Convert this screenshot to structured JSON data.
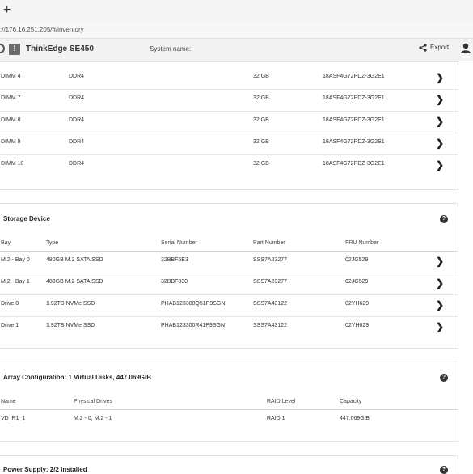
{
  "browser": {
    "new_tab": "+",
    "url": "://176.16.251.205/#/inventory"
  },
  "header": {
    "product_name": "ThinkEdge SE450",
    "system_name_label": "System name:",
    "export_label": "Export",
    "warn_glyph": "!"
  },
  "memory": {
    "rows": [
      {
        "name": "DIMM 4",
        "type": "DDR4",
        "size": "32 GB",
        "part": "18ASF4G72PDZ-3G2E1"
      },
      {
        "name": "DIMM 7",
        "type": "DDR4",
        "size": "32 GB",
        "part": "18ASF4G72PDZ-3G2E1"
      },
      {
        "name": "DIMM 8",
        "type": "DDR4",
        "size": "32 GB",
        "part": "18ASF4G72PDZ-3G2E1"
      },
      {
        "name": "DIMM 9",
        "type": "DDR4",
        "size": "32 GB",
        "part": "18ASF4G72PDZ-3G2E1"
      },
      {
        "name": "DIMM 10",
        "type": "DDR4",
        "size": "32 GB",
        "part": "18ASF4G72PDZ-3G2E1"
      }
    ]
  },
  "storage": {
    "title": "Storage Device",
    "columns": [
      "Bay",
      "Type",
      "Serial Number",
      "Part Number",
      "FRU Number"
    ],
    "rows": [
      {
        "bay": "M.2 - Bay 0",
        "type": "480GB M.2 SATA SSD",
        "serial": "32BBF5E3",
        "part": "SSS7A23277",
        "fru": "02JG529"
      },
      {
        "bay": "M.2 - Bay 1",
        "type": "480GB M.2 SATA SSD",
        "serial": "32BBF830",
        "part": "SSS7A23277",
        "fru": "02JG529"
      },
      {
        "bay": "Drive 0",
        "type": "1.92TB NVMe SSD",
        "serial": "PHAB123300Q51P9SGN",
        "part": "SSS7A43122",
        "fru": "02YH629"
      },
      {
        "bay": "Drive 1",
        "type": "1.92TB NVMe SSD",
        "serial": "PHAB123300R41P9SGN",
        "part": "SSS7A43122",
        "fru": "02YH629"
      }
    ]
  },
  "array": {
    "title": "Array Configuration:  1 Virtual Disks, 447.069GiB",
    "columns": [
      "Name",
      "Physical Drives",
      "RAID Level",
      "Capacity"
    ],
    "rows": [
      {
        "name": "VD_R1_1",
        "drives": "M.2 - 0, M.2 - 1",
        "raid": "RAID 1",
        "capacity": "447.069GiB"
      }
    ]
  },
  "power": {
    "title": "Power Supply: 2/2 Installed"
  },
  "icons": {
    "help": "help-circle-icon",
    "chevron": "chevron-right-icon",
    "share": "share-icon",
    "user": "user-icon",
    "power": "power-icon",
    "warning": "warning-icon"
  }
}
